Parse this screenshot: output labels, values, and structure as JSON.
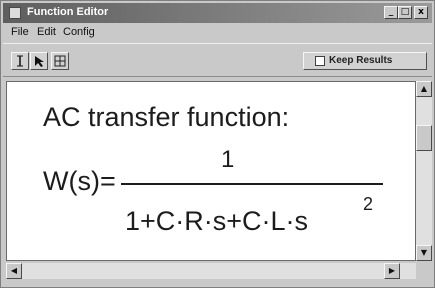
{
  "window": {
    "title": "Function Editor",
    "buttons": {
      "minimize": "_",
      "maximize": "□",
      "close": "x"
    }
  },
  "menu": {
    "items": [
      "File",
      "Edit",
      "Config"
    ]
  },
  "toolbar": {
    "tools": [
      "text-cursor-icon",
      "arrow-pointer-icon",
      "grid-icon"
    ],
    "keep_results_label": "Keep Results",
    "keep_results_checked": false
  },
  "content": {
    "heading": "AC transfer function:",
    "lhs": "W(s)=",
    "numerator": "1",
    "denominator": "1+C·R·s+C·L·s",
    "exponent": "2"
  },
  "scrollbars": {
    "up": "▲",
    "down": "▼",
    "left": "◀",
    "right": "▶"
  },
  "colors": {
    "titlebar_start": "#5e5e5e",
    "titlebar_end": "#9a9a9a",
    "face": "#c9c9c9",
    "canvas": "#ffffff",
    "text": "#1c1c1c"
  }
}
